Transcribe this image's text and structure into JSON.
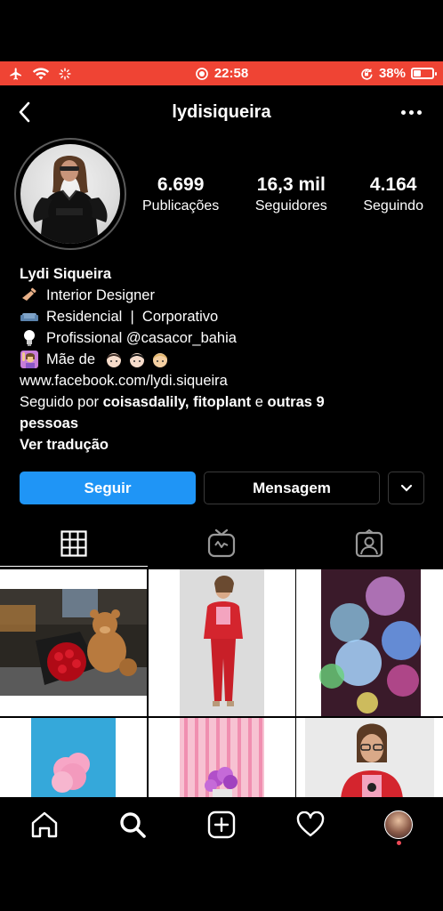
{
  "status_bar": {
    "time": "22:58",
    "battery_text": "38%",
    "battery_level": 0.38,
    "background": "#ef4434"
  },
  "header": {
    "username": "lydisiqueira"
  },
  "stats": [
    {
      "value": "6.699",
      "label": "Publicações"
    },
    {
      "value": "16,3 mil",
      "label": "Seguidores"
    },
    {
      "value": "4.164",
      "label": "Seguindo"
    }
  ],
  "bio": {
    "name": "Lydi Siqueira",
    "lines": [
      {
        "icon": "writing-hand-icon",
        "text": "Interior Designer"
      },
      {
        "icon": "couch-icon",
        "text": "Residencial  |  Corporativo"
      },
      {
        "icon": "lightbulb-icon",
        "text": "Profissional @casacor_bahia"
      },
      {
        "icon": "woman-raising-hand-icon",
        "text": "Mãe de ",
        "suffix_icons": [
          "boy-icon",
          "boy-icon",
          "boy-icon"
        ]
      }
    ],
    "link": "www.facebook.com/lydi.siqueira",
    "followed_by_prefix": "Seguido por ",
    "followed_by_users": "coisasdalily, fitoplant",
    "followed_by_and": " e ",
    "followed_by_others": "outras 9",
    "followed_by_suffix": "pessoas",
    "translate": "Ver tradução"
  },
  "buttons": {
    "follow": "Seguir",
    "message": "Mensagem",
    "follow_color": "#1f95f6"
  },
  "profile_tabs": [
    {
      "icon": "grid-icon",
      "active": true
    },
    {
      "icon": "igtv-icon",
      "active": false
    },
    {
      "icon": "tagged-icon",
      "active": false
    }
  ],
  "bottom_nav": [
    {
      "icon": "home-icon"
    },
    {
      "icon": "search-icon"
    },
    {
      "icon": "new-post-icon"
    },
    {
      "icon": "heart-icon"
    },
    {
      "icon": "profile-avatar-icon"
    }
  ]
}
